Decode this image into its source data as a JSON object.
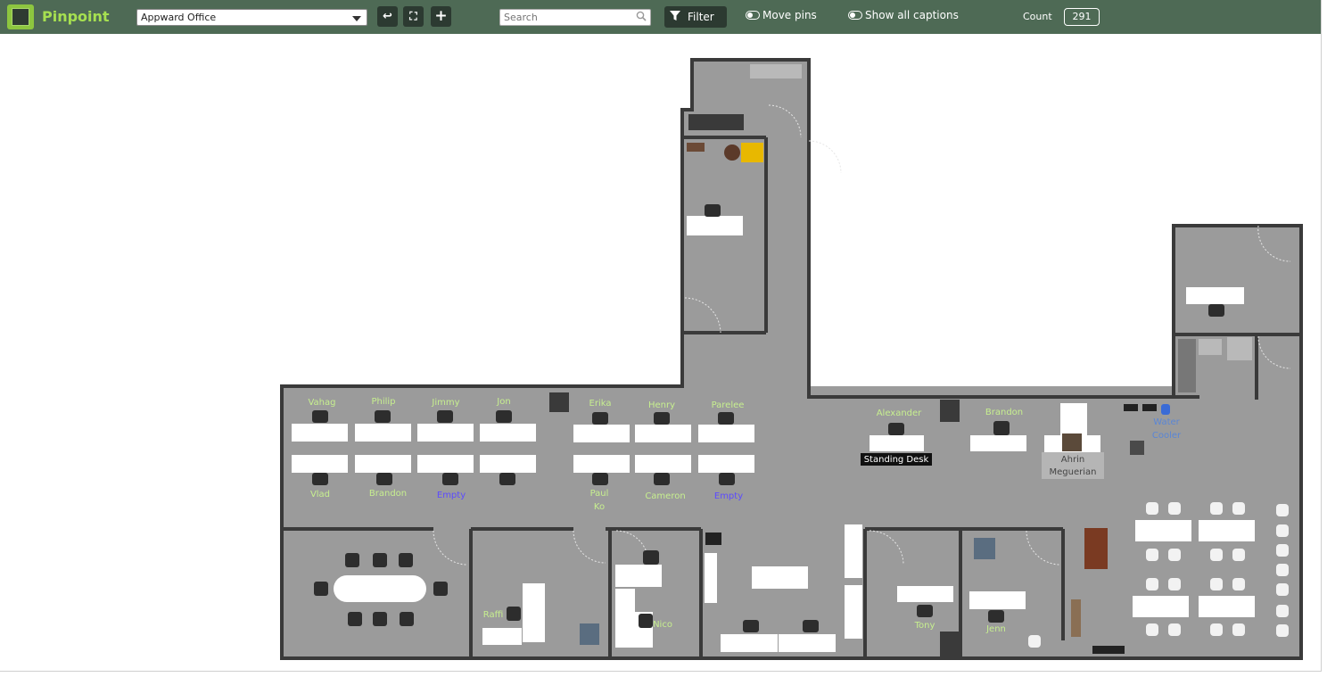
{
  "app": {
    "name": "Pinpoint"
  },
  "toolbar": {
    "office_select": "Appward Office",
    "back_icon": "↩",
    "fullscreen_icon": "⛶",
    "add_icon": "+",
    "search_placeholder": "Search",
    "filter_label": "Filter",
    "move_pins_label": "Move pins",
    "show_captions_label": "Show all captions",
    "count_label": "Count",
    "count_value": "291"
  },
  "map": {
    "labels": {
      "vahag": "Vahag",
      "philip": "Philip",
      "jimmy": "Jimmy",
      "jon": "Jon",
      "erika": "Erika",
      "henry": "Henry",
      "parelee": "Parelee",
      "alexander": "Alexander",
      "brandon_top": "Brandon",
      "vlad": "Vlad",
      "brandon_bottom": "Brandon",
      "empty1": "Empty",
      "paul": "Paul",
      "ko": "Ko",
      "cameron": "Cameron",
      "empty2": "Empty",
      "standing_desk": "Standing Desk",
      "ahrin": "Ahrin",
      "meguerian": "Meguerian",
      "water": "Water",
      "cooler": "Cooler",
      "raffi": "Raffi",
      "nico": "Nico",
      "tony": "Tony",
      "jenn": "Jenn"
    },
    "colors": {
      "name": "#c7ef8f",
      "empty": "#5c4bff",
      "water": "#5a86d6",
      "floor": "#9b9b9b",
      "wall": "#3a3a3a"
    }
  }
}
